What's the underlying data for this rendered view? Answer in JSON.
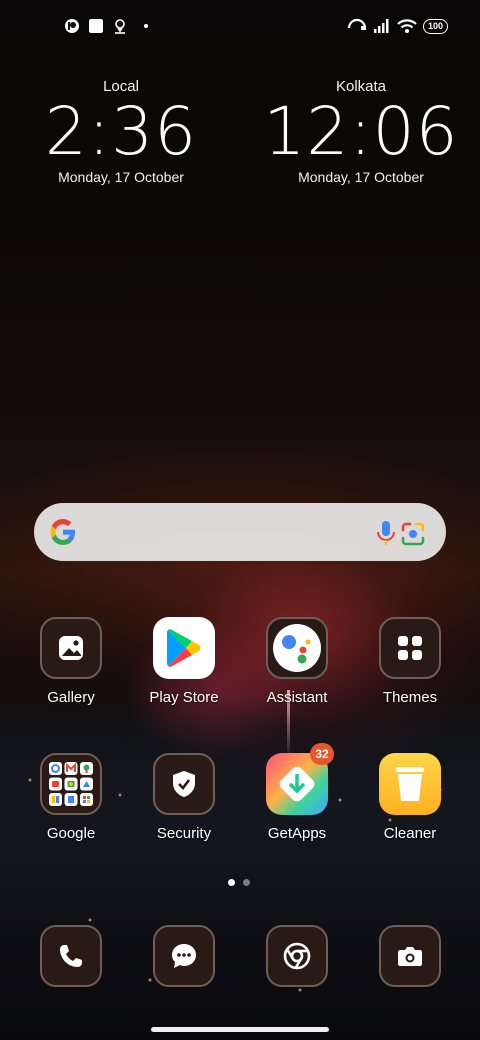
{
  "status_bar": {
    "battery": "100",
    "left_icons": [
      "app-notification-icon",
      "square-notification-icon",
      "location-icon",
      "dot-icon"
    ],
    "right_icons": [
      "hotspot-icon",
      "signal-icon",
      "wifi-icon",
      "battery-icon"
    ]
  },
  "clocks": {
    "local": {
      "city": "Local",
      "time": "2:36",
      "date": "Monday, 17 October"
    },
    "remote": {
      "city": "Kolkata",
      "time": "12:06",
      "date": "Monday, 17 October"
    }
  },
  "search": {
    "icons": [
      "google-logo-icon",
      "microphone-icon",
      "google-lens-icon"
    ]
  },
  "apps": {
    "gallery": {
      "label": "Gallery",
      "icon": "gallery-icon"
    },
    "play_store": {
      "label": "Play Store",
      "icon": "play-store-icon"
    },
    "assistant": {
      "label": "Assistant",
      "icon": "assistant-icon"
    },
    "themes": {
      "label": "Themes",
      "icon": "themes-icon"
    },
    "google": {
      "label": "Google",
      "icon": "google-folder-icon"
    },
    "security": {
      "label": "Security",
      "icon": "shield-check-icon"
    },
    "getapps": {
      "label": "GetApps",
      "icon": "getapps-icon",
      "badge": "32"
    },
    "cleaner": {
      "label": "Cleaner",
      "icon": "trash-can-icon"
    }
  },
  "dock": [
    "phone-icon",
    "messages-icon",
    "chrome-icon",
    "camera-icon"
  ],
  "pages": {
    "count": 2,
    "current": 1
  },
  "colors": {
    "badge": "#e8572b",
    "icon_bg": "#2a1a16",
    "search_bg": "#e4e2e2"
  }
}
